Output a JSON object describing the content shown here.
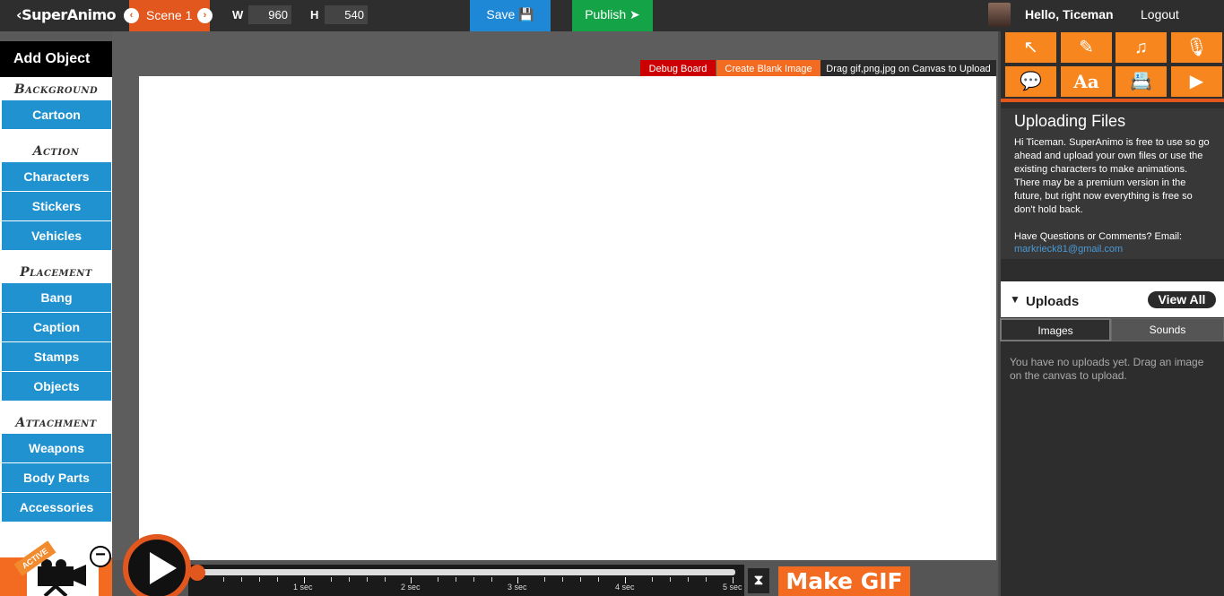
{
  "app": {
    "logo": "‹SuperAnimo"
  },
  "scene": {
    "label": "Scene 1",
    "prev_icon": "‹",
    "next_icon": "›"
  },
  "dimensions": {
    "w_label": "W",
    "w_value": "960",
    "h_label": "H",
    "h_value": "540"
  },
  "toolbar": {
    "save_label": "Save 💾",
    "publish_label": "Publish ➤"
  },
  "user": {
    "greeting": "Hello, Ticeman",
    "logout_label": "Logout"
  },
  "add_object": {
    "title": "Add Object",
    "gear_icon": "⚙"
  },
  "left_menu": {
    "sections": [
      "Background",
      "Action",
      "Placement",
      "Attachment"
    ],
    "background": [
      "Cartoon"
    ],
    "action": [
      "Characters",
      "Stickers",
      "Vehicles"
    ],
    "placement": [
      "Bang",
      "Caption",
      "Stamps",
      "Objects"
    ],
    "attachment": [
      "Weapons",
      "Body Parts",
      "Accessories"
    ]
  },
  "canvas_tabs": {
    "debug": "Debug Board",
    "blank": "Create Blank Image",
    "hint": "Drag gif,png,jpg on Canvas to Upload"
  },
  "tools": {
    "row1": [
      "↖",
      "✎",
      "♫",
      "🎙"
    ],
    "row2": [
      "💬",
      "Aa",
      "📇",
      "▶"
    ],
    "icon_names": [
      "cursor-icon",
      "pencil-icon",
      "music-icon",
      "microphone-icon",
      "speech-bubble-icon",
      "text-icon",
      "contact-card-icon",
      "youtube-icon"
    ]
  },
  "info": {
    "title": "Uploading Files",
    "body": "Hi Ticeman. SuperAnimo is free to use so go ahead and upload your own files or use the existing characters to make animations. There may be a premium version in the future, but right now everything is free so don't hold back.",
    "questions": "Have Questions or Comments? Email:",
    "email": "markrieck81@gmail.com"
  },
  "uploads": {
    "caret": "▼",
    "title": "Uploads",
    "view_all": "View All",
    "tab_images": "Images",
    "tab_sounds": "Sounds",
    "empty_text": "You have no uploads yet. Drag an image on the canvas to upload."
  },
  "timeline": {
    "active_badge": "ACTIVE",
    "minus_icon": "−",
    "tick_labels": [
      "1 sec",
      "2 sec",
      "3 sec",
      "4 sec",
      "5 sec"
    ],
    "hourglass_icon": "⧗",
    "make_gif": "Make GIF"
  },
  "colors": {
    "accent_orange": "#f26b21",
    "blue": "#2092d0",
    "green": "#14a346",
    "red": "#cc0000"
  }
}
